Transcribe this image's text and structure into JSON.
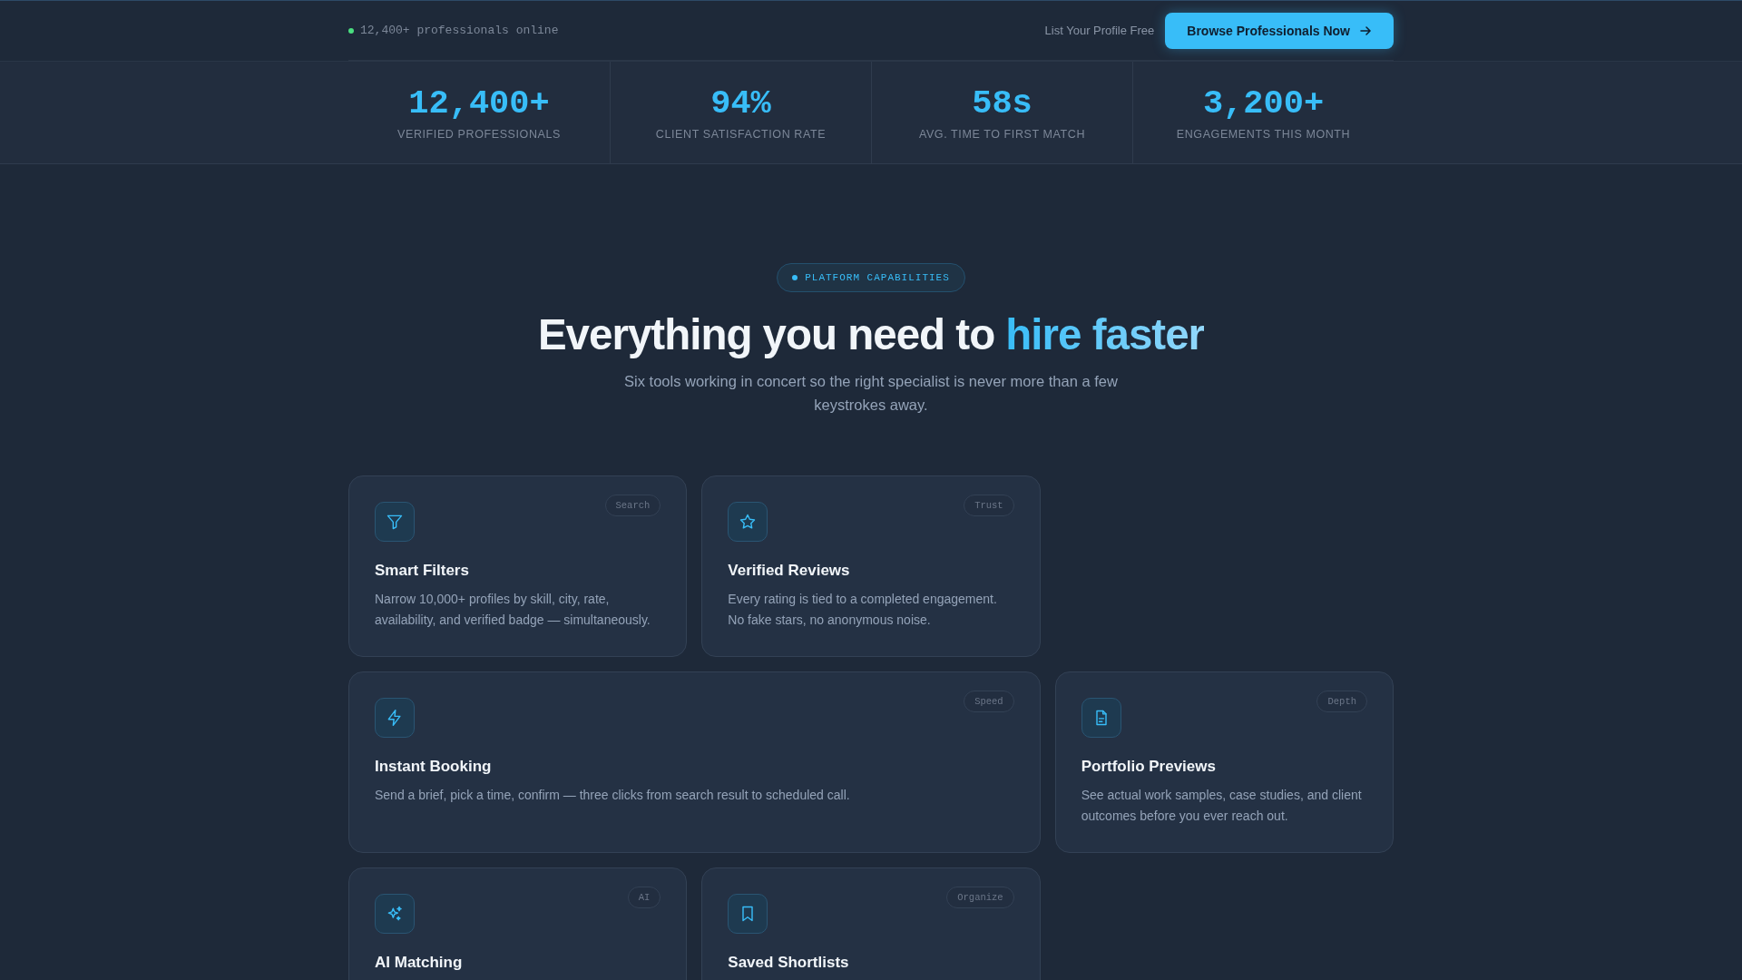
{
  "topbar": {
    "online_status": "12,400+ professionals online",
    "list_link": "List Your Profile Free",
    "cta_button": "Browse Professionals Now"
  },
  "stats": [
    {
      "value": "12,400+",
      "label": "VERIFIED PROFESSIONALS"
    },
    {
      "value": "94%",
      "label": "CLIENT SATISFACTION RATE"
    },
    {
      "value": "58s",
      "label": "AVG. TIME TO FIRST MATCH"
    },
    {
      "value": "3,200+",
      "label": "ENGAGEMENTS THIS MONTH"
    }
  ],
  "section": {
    "eyebrow": "PLATFORM CAPABILITIES",
    "heading": "Everything you need to",
    "heading_highlight": "hire faster",
    "subtitle": "Six tools working in concert so the right specialist is never more than a few keystrokes away."
  },
  "features": [
    {
      "kind": "filter",
      "tag": "Search",
      "title": "Smart Filters",
      "description": "Narrow 10,000+ profiles by skill, city, rate, availability, and verified badge — simultaneously.",
      "wide": false
    },
    {
      "kind": "star",
      "tag": "Trust",
      "title": "Verified Reviews",
      "description": "Every rating is tied to a completed engagement. No fake stars, no anonymous noise.",
      "wide": false
    },
    {
      "kind": "bolt",
      "tag": "Speed",
      "title": "Instant Booking",
      "description": "Send a brief, pick a time, confirm — three clicks from search result to scheduled call.",
      "wide": true
    },
    {
      "kind": "document",
      "tag": "Depth",
      "title": "Portfolio Previews",
      "description": "See actual work samples, case studies, and client outcomes before you ever reach out.",
      "wide": false
    },
    {
      "kind": "sparkles",
      "tag": "AI",
      "title": "AI Matching",
      "wide": false
    },
    {
      "kind": "bookmark",
      "tag": "Organize",
      "title": "Saved Shortlists",
      "wide": false
    }
  ]
}
